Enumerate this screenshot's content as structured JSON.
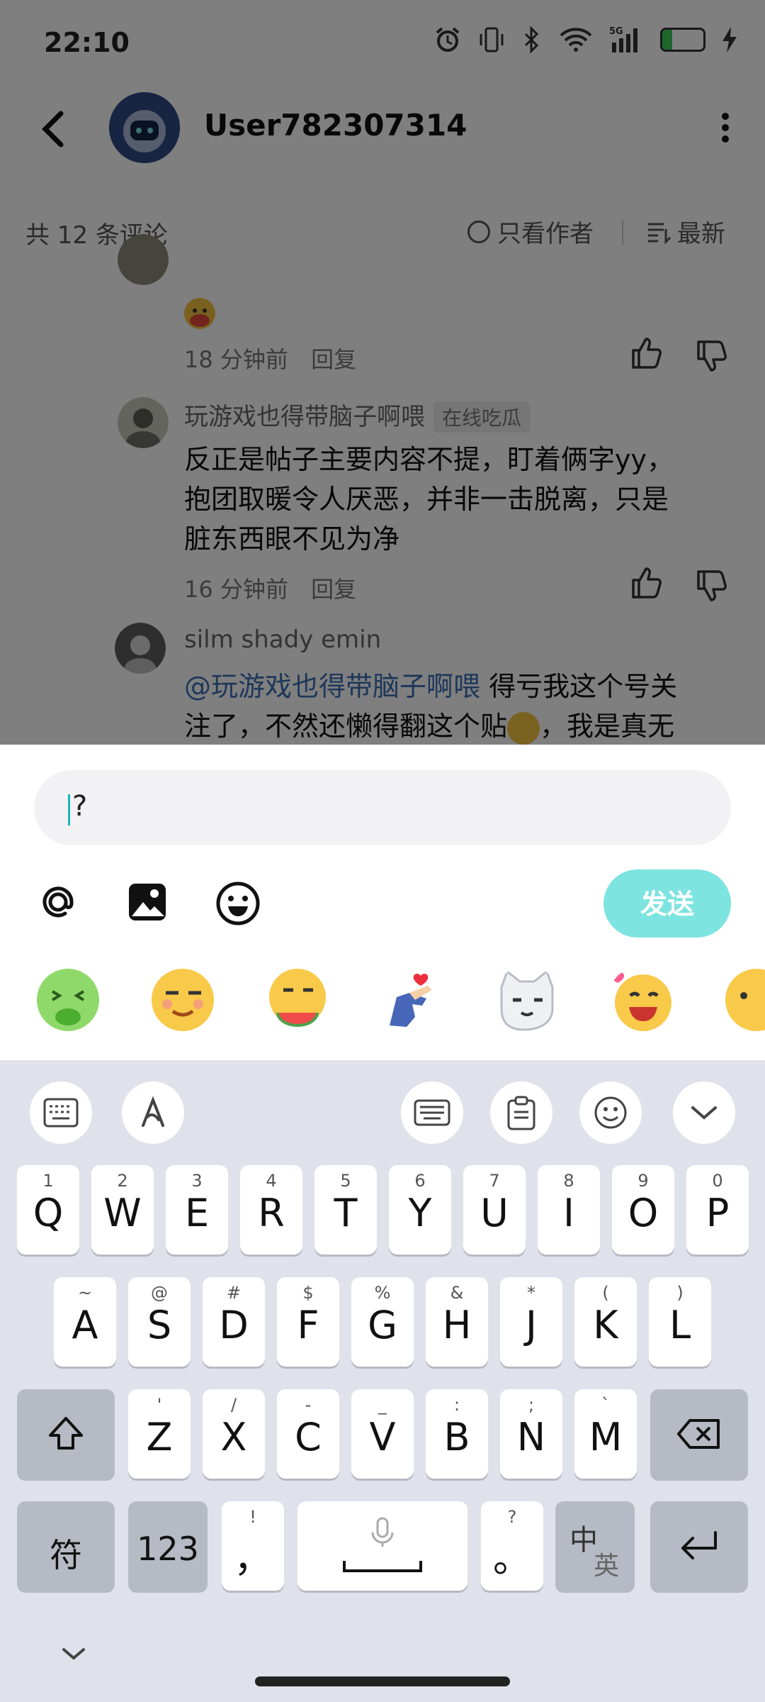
{
  "status_bar": {
    "time": "22:10",
    "network": "5G",
    "battery": "24",
    "icons": [
      "alarm-icon",
      "vibrate-icon",
      "bluetooth-icon",
      "wifi-icon",
      "signal-icon",
      "battery-icon",
      "charging-icon"
    ]
  },
  "header": {
    "username": "User782307314",
    "back_icon": "chevron-left-icon",
    "more_icon": "more-vertical-icon"
  },
  "sort_bar": {
    "count": "共 12 条评论",
    "only_author": "只看作者",
    "sort_label": "最新"
  },
  "comments": [
    {
      "time": "18 分钟前",
      "reply": "回复"
    },
    {
      "name": "玩游戏也得带脑子啊喂",
      "badge": "在线吃瓜",
      "lines": [
        "反正是帖子主要内容不提，盯着俩字yy，",
        "抱团取暖令人厌恶，并非一击脱离，只是",
        "脏东西眼不见为净"
      ],
      "time": "16 分钟前",
      "reply": "回复"
    },
    {
      "name": "silm shady emin",
      "line1_mention": "@玩游戏也得带脑子啊喂",
      "line1_rest": " 得亏我这个号关",
      "line2_a": "注了，不然还懒得翻这个贴",
      "line2_b": "，我是真无"
    }
  ],
  "composer": {
    "input_value": "?",
    "send_label": "发送",
    "accent": "#7de4df"
  },
  "keyboard": {
    "row1": [
      {
        "hint": "1",
        "key": "Q"
      },
      {
        "hint": "2",
        "key": "W"
      },
      {
        "hint": "3",
        "key": "E"
      },
      {
        "hint": "4",
        "key": "R"
      },
      {
        "hint": "5",
        "key": "T"
      },
      {
        "hint": "6",
        "key": "Y"
      },
      {
        "hint": "7",
        "key": "U"
      },
      {
        "hint": "8",
        "key": "I"
      },
      {
        "hint": "9",
        "key": "O"
      },
      {
        "hint": "0",
        "key": "P"
      }
    ],
    "row2": [
      {
        "hint": "~",
        "key": "A"
      },
      {
        "hint": "@",
        "key": "S"
      },
      {
        "hint": "#",
        "key": "D"
      },
      {
        "hint": "$",
        "key": "F"
      },
      {
        "hint": "%",
        "key": "G"
      },
      {
        "hint": "&",
        "key": "H"
      },
      {
        "hint": "*",
        "key": "J"
      },
      {
        "hint": "(",
        "key": "K"
      },
      {
        "hint": ")",
        "key": "L"
      }
    ],
    "row3": [
      {
        "hint": "'",
        "key": "Z"
      },
      {
        "hint": "/",
        "key": "X"
      },
      {
        "hint": "-",
        "key": "C"
      },
      {
        "hint": "_",
        "key": "V"
      },
      {
        "hint": ":",
        "key": "B"
      },
      {
        "hint": ";",
        "key": "N"
      },
      {
        "hint": "`",
        "key": "M"
      }
    ],
    "symbols": "符",
    "numbers": "123",
    "comma_hint": "!",
    "comma": "，",
    "period_hint": "?",
    "period": "。",
    "lang_cn": "中",
    "lang_en": "英"
  }
}
